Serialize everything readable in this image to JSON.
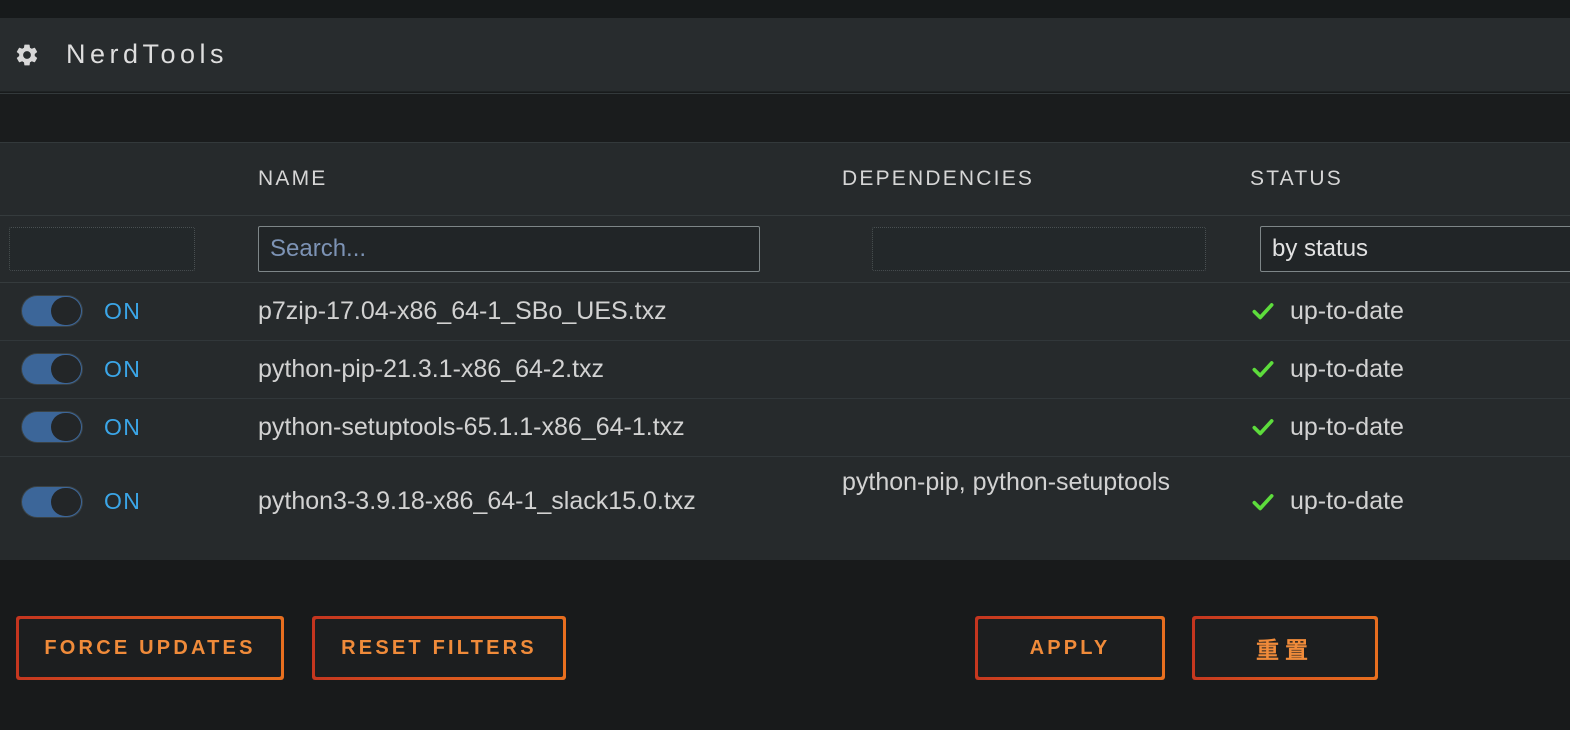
{
  "header": {
    "icon": "gear-icon",
    "title": "NerdTools"
  },
  "table": {
    "columns": [
      {
        "key": "toggle",
        "label": ""
      },
      {
        "key": "name",
        "label": "NAME"
      },
      {
        "key": "dependencies",
        "label": "DEPENDENCIES"
      },
      {
        "key": "status",
        "label": "STATUS"
      }
    ],
    "filters": {
      "toggle_filter": {
        "value": "",
        "placeholder": ""
      },
      "name_filter": {
        "value": "",
        "placeholder": "Search..."
      },
      "dependencies_filter": {
        "value": "",
        "placeholder": ""
      },
      "status_filter": {
        "value": "by status",
        "placeholder": "by status"
      }
    },
    "rows": [
      {
        "toggle_state": "ON",
        "toggle_on": true,
        "name": "p7zip-17.04-x86_64-1_SBo_UES.txz",
        "dependencies": "",
        "status": "up-to-date",
        "status_icon": "check-icon"
      },
      {
        "toggle_state": "ON",
        "toggle_on": true,
        "name": "python-pip-21.3.1-x86_64-2.txz",
        "dependencies": "",
        "status": "up-to-date",
        "status_icon": "check-icon"
      },
      {
        "toggle_state": "ON",
        "toggle_on": true,
        "name": "python-setuptools-65.1.1-x86_64-1.txz",
        "dependencies": "",
        "status": "up-to-date",
        "status_icon": "check-icon"
      },
      {
        "toggle_state": "ON",
        "toggle_on": true,
        "name": "python3-3.9.18-x86_64-1_slack15.0.txz",
        "dependencies": "python-pip, python-setuptools",
        "status": "up-to-date",
        "status_icon": "check-icon"
      }
    ]
  },
  "footer": {
    "buttons": [
      {
        "id": "force-updates",
        "label": "FORCE UPDATES"
      },
      {
        "id": "reset-filters",
        "label": "RESET FILTERS"
      },
      {
        "id": "apply",
        "label": "APPLY"
      },
      {
        "id": "reset-cn",
        "label": "重置"
      }
    ]
  },
  "colors": {
    "accent_orange": "#f08b3a",
    "border_gradient_start": "#c3341f",
    "border_gradient_end": "#e8701f",
    "toggle_on": "#3c6699",
    "on_label": "#3ba6e8",
    "status_ok": "#5ddc3c",
    "panel_bg": "#262a2c",
    "page_bg": "#181a1b",
    "header_bg": "#282c2e"
  }
}
